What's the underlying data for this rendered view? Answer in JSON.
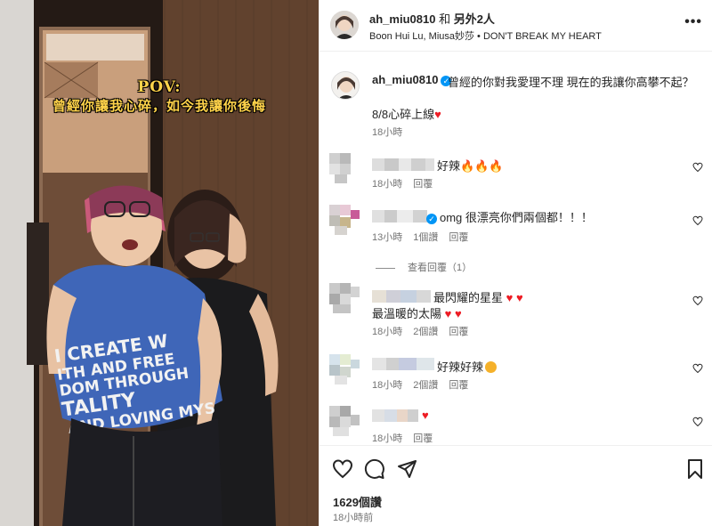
{
  "video": {
    "pov_title": "POV:",
    "pov_subtitle": "曾經你讓我心碎，如今我讓你後悔",
    "shirt_text": "I CREATE W ... FAITH AND FRE ... DOM THROUGH ... TALITY ... AND LOVING MYS"
  },
  "header": {
    "username": "ah_miu0810",
    "and_text": "和",
    "others": "另外2人",
    "subline": "Boon Hui Lu, Miusa妙莎 • DON'T BREAK MY HEART",
    "more_icon": "more-horizontal-icon"
  },
  "caption": {
    "username": "ah_miu0810",
    "text": "曾經的你對我愛理不理 現在的我讓你高攀不起？",
    "line2": "8/8心碎上線",
    "time": "18小時"
  },
  "comments": [
    {
      "text": "好辣🔥🔥🔥",
      "time": "18小時",
      "likes": "",
      "reply": "回覆"
    },
    {
      "text": "omg 很漂亮你們兩個都！！！",
      "time": "13小時",
      "likes": "1個讚",
      "reply": "回覆",
      "verified": true
    },
    {
      "text": "最閃耀的星星",
      "text2": "最溫暖的太陽",
      "time": "18小時",
      "likes": "2個讚",
      "reply": "回覆"
    },
    {
      "text": "好辣好辣",
      "time": "18小時",
      "likes": "2個讚",
      "reply": "回覆"
    },
    {
      "text": "",
      "time": "18小時",
      "likes": "",
      "reply": "回覆"
    }
  ],
  "view_replies": "查看回覆（1）",
  "actions": {
    "like_icon": "heart-icon",
    "comment_icon": "comment-icon",
    "share_icon": "send-icon",
    "save_icon": "bookmark-icon",
    "likes": "1629個讚",
    "time": "18小時前"
  },
  "colors": {
    "accent": "#0095f6",
    "heart": "#ed1c24",
    "pov_text": "#ffd34a",
    "shirt": "#3f66b8"
  }
}
